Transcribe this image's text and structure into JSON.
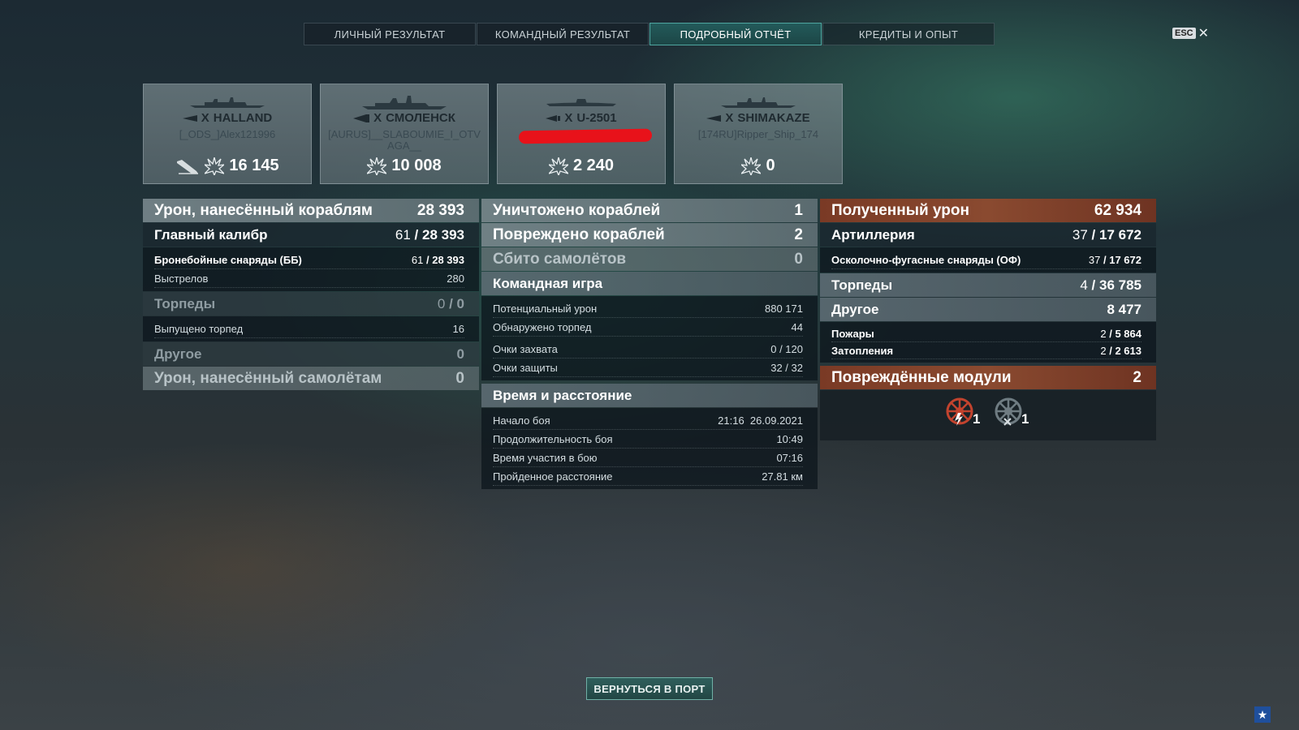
{
  "tabs": [
    {
      "label": "ЛИЧНЫЙ РЕЗУЛЬТАТ",
      "active": false
    },
    {
      "label": "КОМАНДНЫЙ РЕЗУЛЬТАТ",
      "active": false
    },
    {
      "label": "ПОДРОБНЫЙ ОТЧЁТ",
      "active": true
    },
    {
      "label": "КРЕДИТЫ И ОПЫТ",
      "active": false
    }
  ],
  "esc": {
    "key": "ESC",
    "close": "✕"
  },
  "ships": [
    {
      "tier": "X",
      "name": "HALLAND",
      "player": "[_ODS_]Alex121996",
      "damage": "16 145"
    },
    {
      "tier": "X",
      "name": "СМОЛЕНСК",
      "player": "[AURUS]__SLABOUMIE_I_OTVAGA__",
      "damage": "10 008"
    },
    {
      "tier": "X",
      "name": "U-2501",
      "player": "",
      "damage": "2 240"
    },
    {
      "tier": "X",
      "name": "SHIMAKAZE",
      "player": "[174RU]Ripper_Ship_174",
      "damage": "0"
    }
  ],
  "left": {
    "damage_ships": {
      "label": "Урон, нанесённый кораблям",
      "value": "28 393"
    },
    "main_battery": {
      "label": "Главный калибр",
      "hits": "61",
      "value": "28 393"
    },
    "ap_shells": {
      "label": "Бронебойные снаряды (ББ)",
      "hits": "61",
      "value": "28 393"
    },
    "shots": {
      "label": "Выстрелов",
      "value": "280"
    },
    "torpedoes": {
      "label": "Торпеды",
      "hits": "0",
      "value": "0"
    },
    "torps_launched": {
      "label": "Выпущено торпед",
      "value": "16"
    },
    "other": {
      "label": "Другое",
      "value": "0"
    },
    "damage_planes": {
      "label": "Урон, нанесённый самолётам",
      "value": "0"
    }
  },
  "middle": {
    "destroyed": {
      "label": "Уничтожено кораблей",
      "value": "1"
    },
    "damaged": {
      "label": "Повреждено кораблей",
      "value": "2"
    },
    "planes": {
      "label": "Сбито самолётов",
      "value": "0"
    },
    "team": {
      "label": "Командная игра"
    },
    "potential": {
      "label": "Потенциальный урон",
      "value": "880 171"
    },
    "spotted_torps": {
      "label": "Обнаружено торпед",
      "value": "44"
    },
    "capture": {
      "label": "Очки захвата",
      "value": "0 / 120"
    },
    "defense": {
      "label": "Очки защиты",
      "value": "32 / 32"
    },
    "time": {
      "label": "Время и расстояние"
    },
    "start": {
      "label": "Начало боя",
      "value": "21:16  26.09.2021"
    },
    "duration": {
      "label": "Продолжительность боя",
      "value": "10:49"
    },
    "participation": {
      "label": "Время участия в бою",
      "value": "07:16"
    },
    "distance": {
      "label": "Пройденное расстояние",
      "value": "27.81 км"
    }
  },
  "right": {
    "received": {
      "label": "Полученный урон",
      "value": "62 934"
    },
    "artillery": {
      "label": "Артиллерия",
      "hits": "37",
      "value": "17 672"
    },
    "he": {
      "label": "Осколочно-фугасные снаряды (ОФ)",
      "hits": "37",
      "value": "17 672"
    },
    "torpedoes": {
      "label": "Торпеды",
      "hits": "4",
      "value": "36 785"
    },
    "other": {
      "label": "Другое",
      "value": "8 477"
    },
    "fires": {
      "label": "Пожары",
      "hits": "2",
      "value": "5 864"
    },
    "floods": {
      "label": "Затопления",
      "hits": "2",
      "value": "2 613"
    },
    "modules": {
      "label": "Повреждённые модули",
      "value": "2"
    },
    "module_counts": [
      "1",
      "1"
    ]
  },
  "return_button": "ВЕРНУТЬСЯ В ПОРТ",
  "colors": {
    "accent": "#1c4646",
    "received": "#7a3a25"
  }
}
